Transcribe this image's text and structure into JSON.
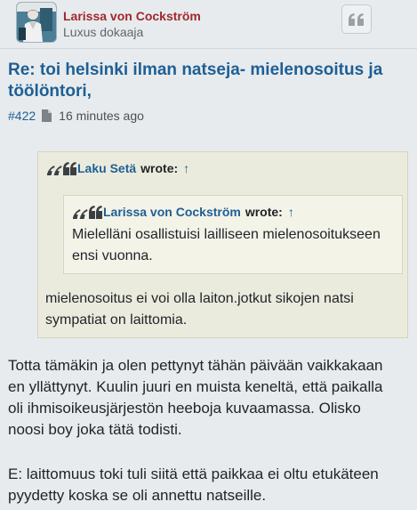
{
  "post": {
    "author": "Larissa von Cockström",
    "rank": "Luxus dokaaja",
    "title": "Re: toi helsinki ilman natseja- mielenosoitus ja töölöntori,",
    "number": "#422",
    "time": "16 minutes ago",
    "colors": {
      "link": "#1d5f95",
      "author": "#a0282d",
      "quote_bg": "#ebebdd"
    }
  },
  "quote": {
    "author": "Laku Setä",
    "wrote": "wrote:",
    "arrow": "↑",
    "nested": {
      "author": "Larissa von Cockström",
      "wrote": "wrote:",
      "arrow": "↑",
      "lines": [
        "Mielelläni osallistuisi lailliseen mielenosoitukseen",
        "ensi vuonna."
      ]
    },
    "lines": [
      "mielenosoitus ei voi olla laiton.jotkut sikojen natsi",
      "sympatiat on laittomia."
    ]
  },
  "body": {
    "para1": [
      "Totta tämäkin ja olen pettynyt tähän päivään vaikkakaan",
      "en yllättynyt. Kuulin juuri en muista keneltä, että paikalla",
      "oli ihmisoikeusjärjestön heeboja kuvaamassa. Olisko",
      "noosi boy joka tätä todisti."
    ],
    "para2": [
      "E: laittomuus toki tuli siitä että paikkaa ei oltu etukäteen",
      "pyydetty koska se oli annettu natseille."
    ]
  }
}
